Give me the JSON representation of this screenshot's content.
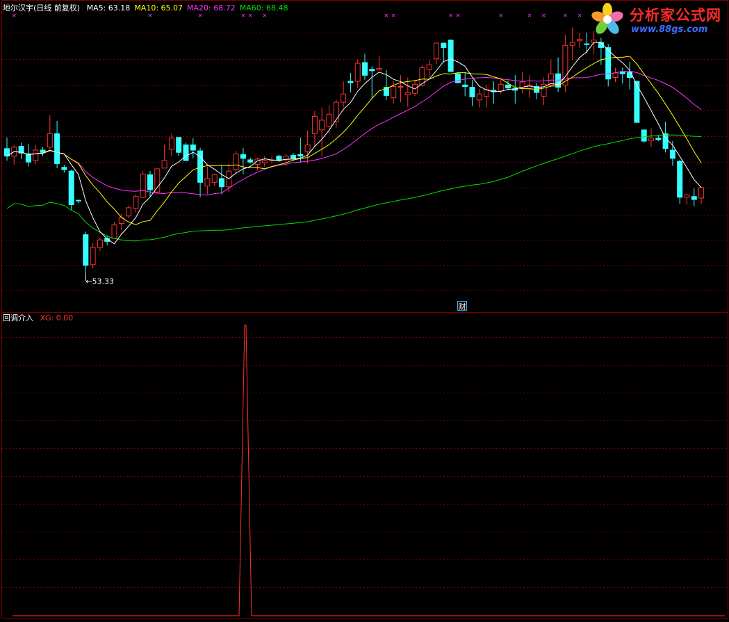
{
  "upper_panel": {
    "stock_label": "地尔汉宇(日线 前复权)",
    "ma_legend": [
      {
        "label": "MA5: ",
        "value": "63.18",
        "color": "#ffffff"
      },
      {
        "label": "MA10: ",
        "value": "65.07",
        "color": "#ffff00"
      },
      {
        "label": "MA20: ",
        "value": "68.72",
        "color": "#ff33ff"
      },
      {
        "label": "MA60: ",
        "value": "68.48",
        "color": "#00e000"
      }
    ],
    "low_annotation": "53.33",
    "event_marker": "财",
    "colors": {
      "up": "#ff3232",
      "down": "#33ffff",
      "ma5": "#ffffff",
      "ma10": "#ffff00",
      "ma20": "#ff33ff",
      "ma60": "#00e000",
      "grid": "#800000",
      "marker": "#ff33ff"
    }
  },
  "lower_panel": {
    "indicator_name": "回调介入",
    "series_label": "XG: ",
    "series_value": "0.00",
    "color": "#ff3232"
  },
  "watermark": {
    "name": "分析家公式网",
    "url": "www.88gs.com"
  },
  "chart_data": [
    {
      "type": "candlestick",
      "title": "地尔汉宇(日线 前复权)",
      "ylim": [
        49,
        88
      ],
      "annotations": [
        {
          "text": "53.33",
          "index": 11,
          "value": 53.33
        }
      ],
      "series": [
        {
          "name": "OHLC",
          "values": [
            [
              70.0,
              71.5,
              68.4,
              69.0
            ],
            [
              69.0,
              70.5,
              67.8,
              70.2
            ],
            [
              70.3,
              70.8,
              68.6,
              69.4
            ],
            [
              69.3,
              70.6,
              67.6,
              68.2
            ],
            [
              68.4,
              70.5,
              67.9,
              69.8
            ],
            [
              69.8,
              70.2,
              69.0,
              69.5
            ],
            [
              70.2,
              74.5,
              69.9,
              72.0
            ],
            [
              72.0,
              73.7,
              67.4,
              68.0
            ],
            [
              67.5,
              67.8,
              66.8,
              67.2
            ],
            [
              67.0,
              67.2,
              61.8,
              62.5
            ],
            [
              63.1,
              63.2,
              62.7,
              63.0
            ],
            [
              58.5,
              58.9,
              53.3,
              54.4
            ],
            [
              54.5,
              57.4,
              54.0,
              56.8
            ],
            [
              56.8,
              58.1,
              56.3,
              57.8
            ],
            [
              58.0,
              58.4,
              57.1,
              57.6
            ],
            [
              58.0,
              60.2,
              58.4,
              59.8
            ],
            [
              60.0,
              61.3,
              59.1,
              60.8
            ],
            [
              61.0,
              62.4,
              60.7,
              62.1
            ],
            [
              62.0,
              63.9,
              61.5,
              63.6
            ],
            [
              63.5,
              67.0,
              63.4,
              66.6
            ],
            [
              66.5,
              67.0,
              63.6,
              64.5
            ],
            [
              64.2,
              67.3,
              64.0,
              67.3
            ],
            [
              67.4,
              70.5,
              67.5,
              68.4
            ],
            [
              69.9,
              72.0,
              69.0,
              71.4
            ],
            [
              71.5,
              71.2,
              69.0,
              69.5
            ],
            [
              70.5,
              70.8,
              68.6,
              68.4
            ],
            [
              70.5,
              71.4,
              68.7,
              69.8
            ],
            [
              69.7,
              70.1,
              63.5,
              65.5
            ],
            [
              65.0,
              67.6,
              63.9,
              66.0
            ],
            [
              65.5,
              66.6,
              65.0,
              66.5
            ],
            [
              66.0,
              67.7,
              63.9,
              64.9
            ],
            [
              64.9,
              68.0,
              64.2,
              67.0
            ],
            [
              67.2,
              69.7,
              66.5,
              69.3
            ],
            [
              69.2,
              70.1,
              66.6,
              68.7
            ],
            [
              68.5,
              68.8,
              68.0,
              68.2
            ],
            [
              67.9,
              68.8,
              67.1,
              68.6
            ],
            [
              68.1,
              69.0,
              67.6,
              68.4
            ],
            [
              68.4,
              69.0,
              68.0,
              68.5
            ],
            [
              69.0,
              69.2,
              68.2,
              68.4
            ],
            [
              68.5,
              69.3,
              67.7,
              69.0
            ],
            [
              69.1,
              69.4,
              68.3,
              68.7
            ],
            [
              69.2,
              71.5,
              68.1,
              69.0
            ],
            [
              69.6,
              72.4,
              68.0,
              70.5
            ],
            [
              72.0,
              75.0,
              70.2,
              74.3
            ],
            [
              72.5,
              75.5,
              69.0,
              73.8
            ],
            [
              73.0,
              75.8,
              72.0,
              74.6
            ],
            [
              73.6,
              76.5,
              72.8,
              76.2
            ],
            [
              76.2,
              79.0,
              75.5,
              77.3
            ],
            [
              79.0,
              80.1,
              77.5,
              78.8
            ],
            [
              79.0,
              81.9,
              78.1,
              81.4
            ],
            [
              81.5,
              82.7,
              79.2,
              79.8
            ],
            [
              80.6,
              81.0,
              76.8,
              80.4
            ],
            [
              80.5,
              82.4,
              80.6,
              80.7
            ],
            [
              78.2,
              80.5,
              76.5,
              77.1
            ],
            [
              76.8,
              79.0,
              76.0,
              78.3
            ],
            [
              78.3,
              79.8,
              76.2,
              78.3
            ],
            [
              77.2,
              79.5,
              75.6,
              77.5
            ],
            [
              77.4,
              79.2,
              77.0,
              78.6
            ],
            [
              78.5,
              81.1,
              78.3,
              80.8
            ],
            [
              80.6,
              81.8,
              79.5,
              81.2
            ],
            [
              82.0,
              83.2,
              81.3,
              84.1
            ],
            [
              84.1,
              84.0,
              81.5,
              83.5
            ],
            [
              84.5,
              84.6,
              81.2,
              80.3
            ],
            [
              80.0,
              80.2,
              78.8,
              78.8
            ],
            [
              78.5,
              80.1,
              77.0,
              78.3
            ],
            [
              78.2,
              79.2,
              75.7,
              76.9
            ],
            [
              76.5,
              78.0,
              75.5,
              77.3
            ],
            [
              77.0,
              78.5,
              75.5,
              77.9
            ],
            [
              77.8,
              79.0,
              76.0,
              77.6
            ],
            [
              77.7,
              79.2,
              77.3,
              78.6
            ],
            [
              78.5,
              79.1,
              77.8,
              78.1
            ],
            [
              78.0,
              79.8,
              76.0,
              77.8
            ],
            [
              78.0,
              80.3,
              77.4,
              78.9
            ],
            [
              78.0,
              79.8,
              76.8,
              78.5
            ],
            [
              78.3,
              78.8,
              76.6,
              77.5
            ],
            [
              77.0,
              79.5,
              75.8,
              78.6
            ],
            [
              78.5,
              81.9,
              78.2,
              80.0
            ],
            [
              80.0,
              82.2,
              77.6,
              78.2
            ],
            [
              78.5,
              85.2,
              77.5,
              83.8
            ],
            [
              83.8,
              86.2,
              81.8,
              84.2
            ],
            [
              84.4,
              85.4,
              83.5,
              84.6
            ],
            [
              84.0,
              85.5,
              82.8,
              83.9
            ],
            [
              84.2,
              85.7,
              82.6,
              84.5
            ],
            [
              84.2,
              84.8,
              81.2,
              83.5
            ],
            [
              83.5,
              84.0,
              78.3,
              79.3
            ],
            [
              79.5,
              80.8,
              78.9,
              80.1
            ],
            [
              80.3,
              80.8,
              78.7,
              80.0
            ],
            [
              80.2,
              81.6,
              77.9,
              79.5
            ],
            [
              79.0,
              78.6,
              74.1,
              73.5
            ],
            [
              72.5,
              72.5,
              70.8,
              71.0
            ],
            [
              71.1,
              72.7,
              70.2,
              71.4
            ],
            [
              71.4,
              71.8,
              71.0,
              71.2
            ],
            [
              72.0,
              73.6,
              69.5,
              70.0
            ],
            [
              69.8,
              71.0,
              67.7,
              68.7
            ],
            [
              68.3,
              68.5,
              62.6,
              63.5
            ],
            [
              63.5,
              64.0,
              62.5,
              63.8
            ],
            [
              63.6,
              64.7,
              62.3,
              63.2
            ],
            [
              63.4,
              64.9,
              62.6,
              64.8
            ]
          ]
        }
      ]
    },
    {
      "type": "line",
      "title": "回调介入",
      "x": [
        0,
        1,
        2,
        3,
        4,
        5,
        6,
        7,
        8,
        9,
        10,
        11,
        12,
        13,
        14,
        15,
        16,
        17,
        18,
        19,
        20,
        21,
        22,
        23,
        24,
        25,
        26,
        27,
        28,
        29,
        30,
        31,
        32,
        33,
        34,
        35,
        36,
        37,
        38,
        39,
        40,
        41,
        42,
        43,
        44,
        45,
        46,
        47,
        48,
        49,
        50,
        51,
        52,
        53,
        54,
        55,
        56,
        57,
        58,
        59,
        60,
        61,
        62,
        63,
        64,
        65,
        66,
        67,
        68,
        69,
        70,
        71,
        72,
        73,
        74,
        75,
        76,
        77,
        78,
        79,
        80,
        81,
        82,
        83,
        84,
        85,
        86,
        87,
        88,
        89,
        90,
        91,
        92,
        93,
        94,
        95,
        96,
        97
      ],
      "series": [
        {
          "name": "XG",
          "values": [
            0,
            0,
            0,
            0,
            0,
            0,
            0,
            0,
            0,
            0,
            0,
            0,
            0,
            0,
            0,
            0,
            0,
            0,
            0,
            0,
            0,
            0,
            0,
            0,
            0,
            0,
            0,
            0,
            0,
            0,
            0,
            0,
            0,
            1,
            0,
            0,
            0,
            0,
            0,
            0,
            0,
            0,
            0,
            0,
            0,
            0,
            0,
            0,
            0,
            0,
            0,
            0,
            0,
            0,
            0,
            0,
            0,
            0,
            0,
            0,
            0,
            0,
            0,
            0,
            0,
            0,
            0,
            0,
            0,
            0,
            0,
            0,
            0,
            0,
            0,
            0,
            0,
            0,
            0,
            0,
            0,
            0,
            0,
            0,
            0,
            0,
            0,
            0,
            0,
            0,
            0,
            0,
            0,
            0,
            0,
            0,
            0,
            0
          ]
        }
      ]
    }
  ]
}
